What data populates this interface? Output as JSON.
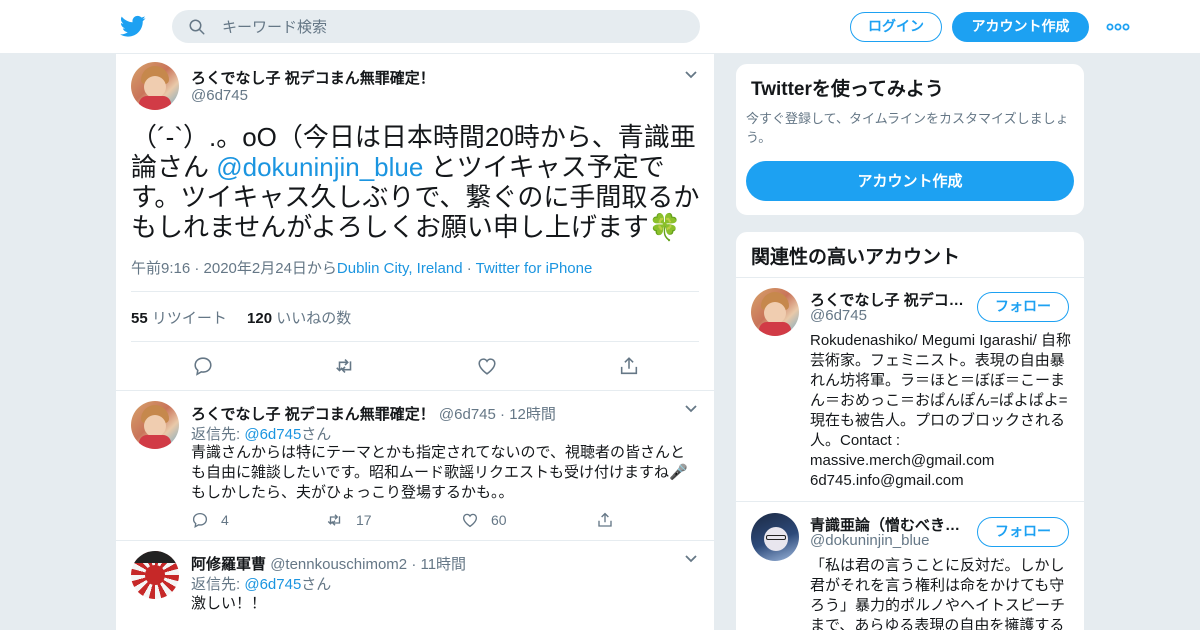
{
  "header": {
    "search_placeholder": "キーワード検索",
    "login_label": "ログイン",
    "signup_label": "アカウント作成"
  },
  "main_tweet": {
    "display_name": "ろくでなし子 祝デコまん無罪確定！",
    "handle": "@6d745",
    "text_before": "（´-`）.。oO（今日は日本時間20時から、青識亜論さん ",
    "mention": "@dokuninjin_blue",
    "text_after": " とツイキャス予定です。ツイキャス久しぶりで、繋ぐのに手間取るかもしれませんがよろしくお願い申し上げます",
    "emoji": "🍀",
    "timestamp": "午前9:16 · 2020年2月24日から",
    "location": "Dublin City, Ireland",
    "separator": " · ",
    "source": "Twitter for iPhone",
    "retweets_count": "55",
    "retweets_label": "リツイート",
    "likes_count": "120",
    "likes_label": "いいねの数"
  },
  "replies": [
    {
      "display_name": "ろくでなし子 祝デコまん無罪確定！",
      "handle": "@6d745",
      "time": "· 12時間",
      "reply_prefix": "返信先: ",
      "reply_mention": "@6d745",
      "reply_suffix": "さん",
      "text": "青識さんからは特にテーマとかも指定されてないので、視聴者の皆さんとも自由に雑談したいです。昭和ムード歌謡リクエストも受け付けますね🎤もしかしたら、夫がひょっこり登場するかも。。",
      "reply_count": "4",
      "retweet_count": "17",
      "like_count": "60"
    },
    {
      "display_name": "阿修羅軍曹",
      "handle": "@tennkouschimom2",
      "time": "· 11時間",
      "reply_prefix": "返信先: ",
      "reply_mention": "@6d745",
      "reply_suffix": "さん",
      "text": "激しい！！"
    }
  ],
  "signup_card": {
    "title": "Twitterを使ってみよう",
    "subtitle": "今すぐ登録して、タイムラインをカスタマイズしましょう。",
    "button": "アカウント作成"
  },
  "related_card": {
    "title": "関連性の高いアカウント",
    "follow_label": "フォロー",
    "accounts": [
      {
        "display_name": "ろくでなし子 祝デコ…",
        "handle": "@6d745",
        "bio": "Rokudenashiko/ Megumi Igarashi/ 自称芸術家。フェミニスト。表現の自由暴れん坊将軍。ラ＝ほと＝ぼぼ＝こーまん＝おめっこ＝おぱんぽん=ぱよぱよ=現在も被告人。プロのブロックされる人。Contact : massive.merch@gmail.com 6d745.info@gmail.com"
      },
      {
        "display_name": "青識亜論（憎むべき…",
        "handle": "@dokuninjin_blue",
        "bio": "「私は君の言うことに反対だ。しかし君がそれを言う権利は命をかけても守ろう」暴力的ポルノやヘイトスピーチまで、あらゆる表現の自由を擁護する"
      }
    ]
  },
  "colors": {
    "brand": "#1da1f2",
    "link": "#1b95e0",
    "muted": "#657786",
    "background": "#e6ecf0"
  },
  "icons": [
    "twitter-bird-icon",
    "search-icon",
    "more-icon",
    "chevron-down-icon",
    "reply-icon",
    "retweet-icon",
    "like-icon",
    "share-icon",
    "clover-emoji"
  ]
}
